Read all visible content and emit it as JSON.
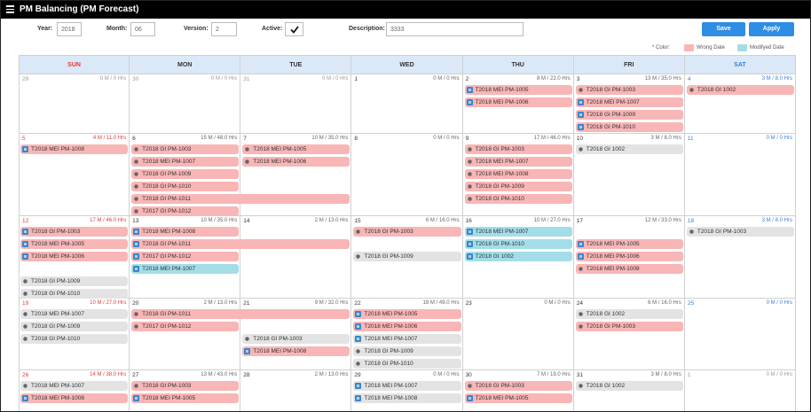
{
  "app": {
    "title": "PM Balancing (PM Forecast)"
  },
  "filters": {
    "year_label": "Year:",
    "year_value": "2018",
    "month_label": "Month:",
    "month_value": "06",
    "version_label": "Version:",
    "version_value": "2",
    "active_label": "Active:",
    "description_label": "Description:",
    "description_value": "3333"
  },
  "buttons": {
    "save": "Save",
    "apply": "Apply"
  },
  "legend": {
    "color_label": "* Color:",
    "wrong_date": "Wrong Date",
    "modified_date": "Modifyed Date",
    "wrong_color": "#f8b6b6",
    "modified_color": "#a3dde8"
  },
  "weekdays": [
    "SUN",
    "MON",
    "TUE",
    "WED",
    "THU",
    "FRI",
    "SAT"
  ],
  "weeks": [
    {
      "days": [
        {
          "num": "29",
          "sum": "0 M / 0 Hrs",
          "out": true
        },
        {
          "num": "30",
          "sum": "0 M / 0 Hrs",
          "out": true
        },
        {
          "num": "31",
          "sum": "0 M / 0 Hrs",
          "out": true
        },
        {
          "num": "1",
          "sum": "0 M / 0 Hrs"
        },
        {
          "num": "2",
          "sum": "8 M / 22.0 Hrs"
        },
        {
          "num": "3",
          "sum": "13 M / 35.0 Hrs"
        },
        {
          "num": "4",
          "sum": "3 M / 8.0 Hrs"
        }
      ]
    },
    {
      "days": [
        {
          "num": "5",
          "sum": "4 M / 11.0 Hrs"
        },
        {
          "num": "6",
          "sum": "15 M / 48.0 Hrs"
        },
        {
          "num": "7",
          "sum": "10 M / 35.0 Hrs"
        },
        {
          "num": "8",
          "sum": "0 M / 0 Hrs"
        },
        {
          "num": "9",
          "sum": "17 M / 46.0 Hrs"
        },
        {
          "num": "10",
          "sum": "3 M / 8.0 Hrs"
        },
        {
          "num": "11",
          "sum": "0 M / 0 Hrs"
        }
      ]
    },
    {
      "days": [
        {
          "num": "12",
          "sum": "17 M / 46.0 Hrs"
        },
        {
          "num": "13",
          "sum": "10 M / 35.0 Hrs"
        },
        {
          "num": "14",
          "sum": "2 M / 13.0 Hrs"
        },
        {
          "num": "15",
          "sum": "6 M / 16.0 Hrs"
        },
        {
          "num": "16",
          "sum": "10 M / 27.0 Hrs"
        },
        {
          "num": "17",
          "sum": "12 M / 33.0 Hrs"
        },
        {
          "num": "18",
          "sum": "3 M / 8.0 Hrs"
        }
      ]
    },
    {
      "days": [
        {
          "num": "19",
          "sum": "10 M / 27.0 Hrs"
        },
        {
          "num": "20",
          "sum": "2 M / 13.0 Hrs"
        },
        {
          "num": "21",
          "sum": "9 M / 32.0 Hrs"
        },
        {
          "num": "22",
          "sum": "18 M / 49.0 Hrs"
        },
        {
          "num": "23",
          "sum": "0 M / 0 Hrs"
        },
        {
          "num": "24",
          "sum": "6 M / 16.0 Hrs"
        },
        {
          "num": "25",
          "sum": "0 M / 0 Hrs"
        }
      ]
    },
    {
      "days": [
        {
          "num": "26",
          "sum": "14 M / 38.0 Hrs"
        },
        {
          "num": "27",
          "sum": "13 M / 43.0 Hrs"
        },
        {
          "num": "28",
          "sum": "2 M / 13.0 Hrs"
        },
        {
          "num": "29",
          "sum": "0 M / 0 Hrs"
        },
        {
          "num": "30",
          "sum": "7 M / 19.0 Hrs"
        },
        {
          "num": "31",
          "sum": "3 M / 8.0 Hrs"
        },
        {
          "num": "1",
          "sum": "0 M / 0 Hrs",
          "out": true
        }
      ]
    }
  ],
  "events": [
    {
      "week": 0,
      "day": 4,
      "row": 0,
      "span": 1,
      "label": "T2018 MEI PM-1005",
      "color": "pink",
      "icon": "calendar-icon"
    },
    {
      "week": 0,
      "day": 4,
      "row": 1,
      "span": 1,
      "label": "T2018 MEI PM-1006",
      "color": "pink",
      "icon": "calendar-icon"
    },
    {
      "week": 0,
      "day": 5,
      "row": 0,
      "span": 1,
      "label": "T2018 GI PM-1003",
      "color": "pink",
      "icon": "gear-icon"
    },
    {
      "week": 0,
      "day": 5,
      "row": 1,
      "span": 1,
      "label": "T2018 MEI PM-1007",
      "color": "pink",
      "icon": "calendar-icon"
    },
    {
      "week": 0,
      "day": 5,
      "row": 2,
      "span": 1,
      "label": "T2018 GI PM-1009",
      "color": "pink",
      "icon": "calendar-icon"
    },
    {
      "week": 0,
      "day": 5,
      "row": 3,
      "span": 1,
      "label": "T2018 GI PM-1010",
      "color": "pink",
      "icon": "calendar-icon"
    },
    {
      "week": 0,
      "day": 6,
      "row": 0,
      "span": 1,
      "label": "T2018 GI 1002",
      "color": "pink",
      "icon": "gear-icon"
    },
    {
      "week": 1,
      "day": 0,
      "row": 0,
      "span": 1,
      "label": "T2018 MEI PM-1008",
      "color": "pink",
      "icon": "calendar-icon"
    },
    {
      "week": 1,
      "day": 1,
      "row": 0,
      "span": 1,
      "label": "T2018 GI PM-1003",
      "color": "pink",
      "icon": "gear-icon"
    },
    {
      "week": 1,
      "day": 1,
      "row": 1,
      "span": 1,
      "label": "T2018 MEI PM-1007",
      "color": "pink",
      "icon": "gear-icon"
    },
    {
      "week": 1,
      "day": 1,
      "row": 2,
      "span": 1,
      "label": "T2018 GI PM-1009",
      "color": "pink",
      "icon": "gear-icon"
    },
    {
      "week": 1,
      "day": 1,
      "row": 3,
      "span": 1,
      "label": "T2018 GI PM-1010",
      "color": "pink",
      "icon": "gear-icon"
    },
    {
      "week": 1,
      "day": 1,
      "row": 4,
      "span": 2,
      "label": "T2018 GI PM-1011",
      "color": "pink",
      "icon": "gear-icon"
    },
    {
      "week": 1,
      "day": 1,
      "row": 5,
      "span": 1,
      "label": "T2017 GI PM-1012",
      "color": "pink",
      "icon": "gear-icon"
    },
    {
      "week": 1,
      "day": 2,
      "row": 0,
      "span": 1,
      "label": "T2018 MEI PM-1005",
      "color": "pink",
      "icon": "gear-icon"
    },
    {
      "week": 1,
      "day": 2,
      "row": 1,
      "span": 1,
      "label": "T2018 MEI PM-1006",
      "color": "pink",
      "icon": "gear-icon"
    },
    {
      "week": 1,
      "day": 4,
      "row": 0,
      "span": 1,
      "label": "T2018 GI PM-1003",
      "color": "pink",
      "icon": "gear-icon"
    },
    {
      "week": 1,
      "day": 4,
      "row": 1,
      "span": 1,
      "label": "T2018 MEI PM-1007",
      "color": "pink",
      "icon": "gear-icon"
    },
    {
      "week": 1,
      "day": 4,
      "row": 2,
      "span": 1,
      "label": "T2018 MEI PM-1008",
      "color": "pink",
      "icon": "gear-icon"
    },
    {
      "week": 1,
      "day": 4,
      "row": 3,
      "span": 1,
      "label": "T2018 GI PM-1009",
      "color": "pink",
      "icon": "gear-icon"
    },
    {
      "week": 1,
      "day": 4,
      "row": 4,
      "span": 1,
      "label": "T2018 GI PM-1010",
      "color": "pink",
      "icon": "gear-icon"
    },
    {
      "week": 1,
      "day": 5,
      "row": 0,
      "span": 1,
      "label": "T2018 GI 1002",
      "color": "grey",
      "icon": "gear-icon"
    },
    {
      "week": 2,
      "day": 0,
      "row": 0,
      "span": 1,
      "label": "T2018 GI PM-1003",
      "color": "pink",
      "icon": "calendar-icon"
    },
    {
      "week": 2,
      "day": 0,
      "row": 1,
      "span": 1,
      "label": "T2018 MEI PM-1005",
      "color": "pink",
      "icon": "calendar-icon"
    },
    {
      "week": 2,
      "day": 0,
      "row": 2,
      "span": 1,
      "label": "T2018 MEI PM-1006",
      "color": "pink",
      "icon": "calendar-icon"
    },
    {
      "week": 2,
      "day": 0,
      "row": 4,
      "span": 1,
      "label": "T2018 GI PM-1009",
      "color": "grey",
      "icon": "gear-icon"
    },
    {
      "week": 2,
      "day": 0,
      "row": 5,
      "span": 1,
      "label": "T2018 GI PM-1010",
      "color": "grey",
      "icon": "gear-icon"
    },
    {
      "week": 2,
      "day": 1,
      "row": 0,
      "span": 1,
      "label": "T2018 MEI PM-1008",
      "color": "pink",
      "icon": "calendar-icon"
    },
    {
      "week": 2,
      "day": 1,
      "row": 1,
      "span": 2,
      "label": "T2018 GI PM-1011",
      "color": "pink",
      "icon": "calendar-icon"
    },
    {
      "week": 2,
      "day": 1,
      "row": 2,
      "span": 1,
      "label": "T2017 GI PM-1012",
      "color": "pink",
      "icon": "calendar-icon"
    },
    {
      "week": 2,
      "day": 1,
      "row": 3,
      "span": 1,
      "label": "T2018 MEI PM-1007",
      "color": "teal",
      "icon": "calendar-icon"
    },
    {
      "week": 2,
      "day": 3,
      "row": 0,
      "span": 1,
      "label": "T2018 GI PM-1003",
      "color": "pink",
      "icon": "gear-icon"
    },
    {
      "week": 2,
      "day": 3,
      "row": 2,
      "span": 1,
      "label": "T2018 GI PM-1009",
      "color": "grey",
      "icon": "gear-icon"
    },
    {
      "week": 2,
      "day": 4,
      "row": 0,
      "span": 1,
      "label": "T2018 MEI PM-1007",
      "color": "teal",
      "icon": "calendar-icon"
    },
    {
      "week": 2,
      "day": 4,
      "row": 1,
      "span": 1,
      "label": "T2018 GI PM-1010",
      "color": "teal",
      "icon": "calendar-icon"
    },
    {
      "week": 2,
      "day": 4,
      "row": 2,
      "span": 1,
      "label": "T2018 GI 1002",
      "color": "teal",
      "icon": "calendar-icon"
    },
    {
      "week": 2,
      "day": 5,
      "row": 1,
      "span": 1,
      "label": "T2018 MEI PM-1005",
      "color": "pink",
      "icon": "calendar-icon"
    },
    {
      "week": 2,
      "day": 5,
      "row": 2,
      "span": 1,
      "label": "T2018 MEI PM-1006",
      "color": "pink",
      "icon": "calendar-icon"
    },
    {
      "week": 2,
      "day": 5,
      "row": 3,
      "span": 1,
      "label": "T2018 MEI PM-1008",
      "color": "pink",
      "icon": "gear-icon"
    },
    {
      "week": 2,
      "day": 6,
      "row": 0,
      "span": 1,
      "label": "T2018 GI PM-1003",
      "color": "grey",
      "icon": "gear-icon"
    },
    {
      "week": 3,
      "day": 0,
      "row": 0,
      "span": 1,
      "label": "T2018 MEI PM-1007",
      "color": "grey",
      "icon": "gear-icon"
    },
    {
      "week": 3,
      "day": 0,
      "row": 1,
      "span": 1,
      "label": "T2018 GI PM-1009",
      "color": "grey",
      "icon": "gear-icon"
    },
    {
      "week": 3,
      "day": 0,
      "row": 2,
      "span": 1,
      "label": "T2018 GI PM-1010",
      "color": "grey",
      "icon": "gear-icon"
    },
    {
      "week": 3,
      "day": 1,
      "row": 0,
      "span": 2,
      "label": "T2018 GI PM-1011",
      "color": "pink",
      "icon": "gear-icon"
    },
    {
      "week": 3,
      "day": 1,
      "row": 1,
      "span": 1,
      "label": "T2017 GI PM-1012",
      "color": "pink",
      "icon": "gear-icon"
    },
    {
      "week": 3,
      "day": 2,
      "row": 2,
      "span": 1,
      "label": "T2018 GI PM-1003",
      "color": "grey",
      "icon": "gear-icon"
    },
    {
      "week": 3,
      "day": 2,
      "row": 3,
      "span": 1,
      "label": "T2018 MEI PM-1008",
      "color": "pink",
      "icon": "calendar-icon"
    },
    {
      "week": 3,
      "day": 3,
      "row": 0,
      "span": 1,
      "label": "T2018 MEI PM-1005",
      "color": "pink",
      "icon": "calendar-icon"
    },
    {
      "week": 3,
      "day": 3,
      "row": 1,
      "span": 1,
      "label": "T2018 MEI PM-1006",
      "color": "pink",
      "icon": "calendar-icon"
    },
    {
      "week": 3,
      "day": 3,
      "row": 2,
      "span": 1,
      "label": "T2018 MEI PM-1007",
      "color": "grey",
      "icon": "calendar-icon"
    },
    {
      "week": 3,
      "day": 3,
      "row": 3,
      "span": 1,
      "label": "T2018 GI PM-1009",
      "color": "grey",
      "icon": "gear-icon"
    },
    {
      "week": 3,
      "day": 3,
      "row": 4,
      "span": 1,
      "label": "T2018 GI PM-1010",
      "color": "grey",
      "icon": "gear-icon"
    },
    {
      "week": 3,
      "day": 5,
      "row": 0,
      "span": 1,
      "label": "T2018 GI 1002",
      "color": "grey",
      "icon": "gear-icon"
    },
    {
      "week": 3,
      "day": 5,
      "row": 1,
      "span": 1,
      "label": "T2018 GI PM-1003",
      "color": "pink",
      "icon": "gear-icon"
    },
    {
      "week": 4,
      "day": 0,
      "row": 0,
      "span": 1,
      "label": "T2018 MEI PM-1007",
      "color": "grey",
      "icon": "gear-icon"
    },
    {
      "week": 4,
      "day": 0,
      "row": 1,
      "span": 1,
      "label": "T2018 MEI PM-1008",
      "color": "pink",
      "icon": "calendar-icon"
    },
    {
      "week": 4,
      "day": 1,
      "row": 0,
      "span": 1,
      "label": "T2018 GI PM-1003",
      "color": "pink",
      "icon": "gear-icon"
    },
    {
      "week": 4,
      "day": 1,
      "row": 1,
      "span": 1,
      "label": "T2018 MEI PM-1005",
      "color": "pink",
      "icon": "calendar-icon"
    },
    {
      "week": 4,
      "day": 3,
      "row": 0,
      "span": 1,
      "label": "T2018 MEI PM-1007",
      "color": "grey",
      "icon": "calendar-icon"
    },
    {
      "week": 4,
      "day": 3,
      "row": 1,
      "span": 1,
      "label": "T2018 MEI PM-1008",
      "color": "grey",
      "icon": "calendar-icon"
    },
    {
      "week": 4,
      "day": 4,
      "row": 0,
      "span": 1,
      "label": "T2018 GI PM-1003",
      "color": "pink",
      "icon": "gear-icon"
    },
    {
      "week": 4,
      "day": 4,
      "row": 1,
      "span": 1,
      "label": "T2018 MEI PM-1005",
      "color": "pink",
      "icon": "calendar-icon"
    },
    {
      "week": 4,
      "day": 5,
      "row": 0,
      "span": 1,
      "label": "T2018 GI 1002",
      "color": "grey",
      "icon": "gear-icon"
    }
  ]
}
